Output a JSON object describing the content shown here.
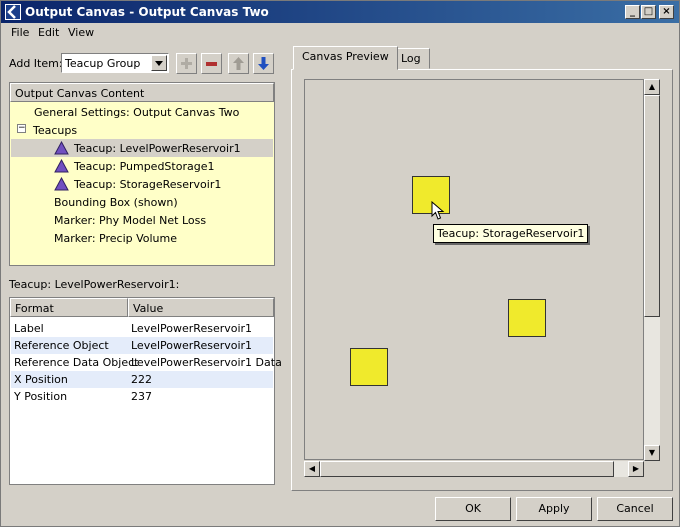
{
  "window": {
    "title": "Output Canvas - Output Canvas Two"
  },
  "menu": [
    "File",
    "Edit",
    "View"
  ],
  "add_item": {
    "label": "Add Item:",
    "selected": "Teacup Group"
  },
  "tree": {
    "header": "Output Canvas Content",
    "rows": [
      "General Settings: Output Canvas Two",
      "Teacups",
      "Teacup: LevelPowerReservoir1",
      "Teacup: PumpedStorage1",
      "Teacup: StorageReservoir1",
      "Bounding Box (shown)",
      "Marker: Phy Model Net Loss",
      "Marker: Precip Volume"
    ],
    "expand_glyph": "−"
  },
  "selection_label": "Teacup: LevelPowerReservoir1:",
  "properties": {
    "headers": [
      "Format",
      "Value"
    ],
    "rows": [
      [
        "Label",
        "LevelPowerReservoir1"
      ],
      [
        "Reference Object",
        "LevelPowerReservoir1"
      ],
      [
        "Reference Data Object",
        "LevelPowerReservoir1 Data"
      ],
      [
        "X Position",
        "222"
      ],
      [
        "Y Position",
        "237"
      ]
    ]
  },
  "tabs": [
    "Canvas Preview",
    "Log"
  ],
  "canvas": {
    "tooltip": "Teacup: StorageReservoir1"
  },
  "buttons": {
    "ok": "OK",
    "apply": "Apply",
    "cancel": "Cancel"
  },
  "colors": {
    "title_bar": "#0a246a",
    "tree_highlight": "#ffffc8",
    "teacup": "#f0ea2c"
  }
}
